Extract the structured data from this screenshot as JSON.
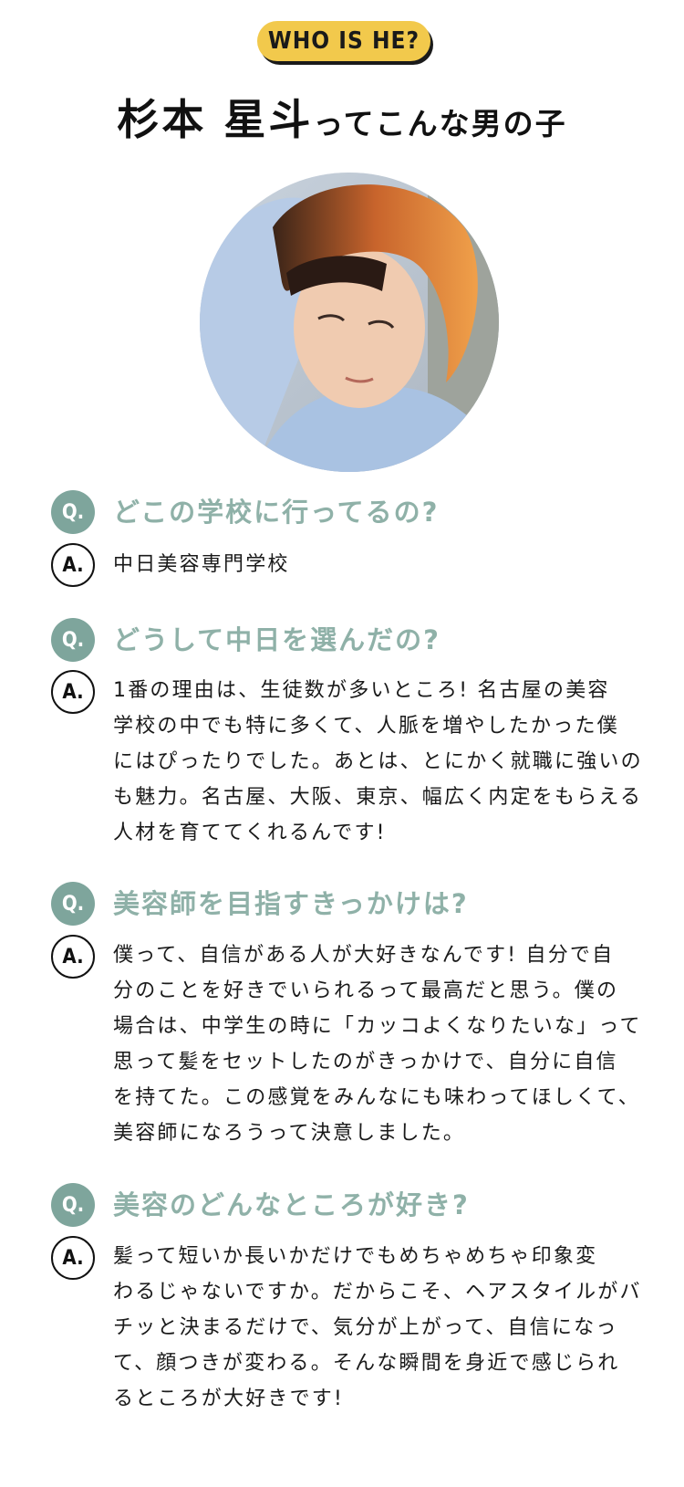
{
  "header": {
    "badge": "WHO IS HE?",
    "name": "杉本 星斗",
    "subtitle": "ってこんな男の子"
  },
  "photo": {
    "icon": "portrait-photo"
  },
  "qa": [
    {
      "q_marker": "Q.",
      "a_marker": "A.",
      "question": "どこの学校に行ってるの?",
      "answer_lines": [
        "中日美容専門学校"
      ]
    },
    {
      "q_marker": "Q.",
      "a_marker": "A.",
      "question": "どうして中日を選んだの?",
      "answer_lines": [
        "1番の理由は、生徒数が多いところ! 名古屋の美容",
        "学校の中でも特に多くて、人脈を増やしたかった僕",
        "にはぴったりでした。あとは、とにかく就職に強いの",
        "も魅力。名古屋、大阪、東京、幅広く内定をもらえる",
        "人材を育ててくれるんです!"
      ]
    },
    {
      "q_marker": "Q.",
      "a_marker": "A.",
      "question": "美容師を目指すきっかけは?",
      "answer_lines": [
        "僕って、自信がある人が大好きなんです! 自分で自",
        "分のことを好きでいられるって最高だと思う。僕の",
        "場合は、中学生の時に「カッコよくなりたいな」って",
        "思って髪をセットしたのがきっかけで、自分に自信",
        "を持てた。この感覚をみんなにも味わってほしくて、",
        "美容師になろうって決意しました。"
      ]
    },
    {
      "q_marker": "Q.",
      "a_marker": "A.",
      "question": "美容のどんなところが好き?",
      "answer_lines": [
        "髪って短いか長いかだけでもめちゃめちゃ印象変",
        "わるじゃないですか。だからこそ、ヘアスタイルがバ",
        "チッと決まるだけで、気分が上がって、自信になっ",
        "て、顔つきが変わる。そんな瞬間を身近で感じられ",
        "るところが大好きです!"
      ]
    }
  ]
}
